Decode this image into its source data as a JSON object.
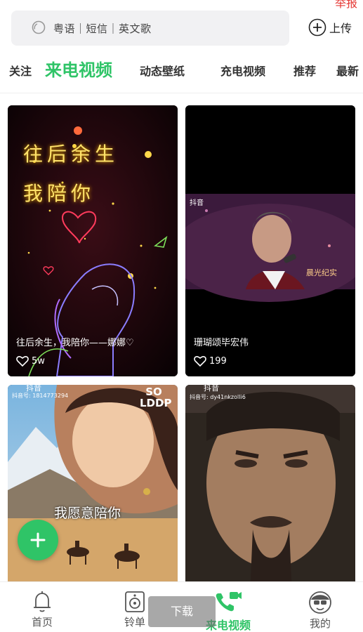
{
  "report_corner": "举报",
  "search": {
    "text": "粤语｜短信｜英文歌"
  },
  "upload_label": "上传",
  "tabs": [
    "关注",
    "来电视频",
    "动态壁纸",
    "充电视频",
    "推荐",
    "最新"
  ],
  "active_tab_index": 1,
  "cards": [
    {
      "caption": "往后余生，我陪你——娜娜♡",
      "likes": "5w",
      "overlay_text": "往后余生 我陪你"
    },
    {
      "caption": "珊瑚颂毕宏伟",
      "likes": "199",
      "watermark": "抖音",
      "stage_text": "晨光纪实"
    },
    {
      "watermark_top": "抖音",
      "watermark_id": "抖音号: 1814773294",
      "badge": "SO LDDP",
      "subtitle": "我愿意陪你"
    },
    {
      "watermark_top": "抖音",
      "watermark_id": "抖音号: dy41nkzolli6"
    }
  ],
  "bottom_nav": [
    {
      "label": "首页",
      "icon": "bell-icon"
    },
    {
      "label": "铃单",
      "icon": "speaker-icon"
    },
    {
      "label": "来电视频",
      "icon": "video-call-icon"
    },
    {
      "label": "我的",
      "icon": "avatar-icon"
    }
  ],
  "active_nav_index": 2,
  "download_toast": "下载",
  "colors": {
    "accent": "#2fc467",
    "report": "#e53935"
  }
}
